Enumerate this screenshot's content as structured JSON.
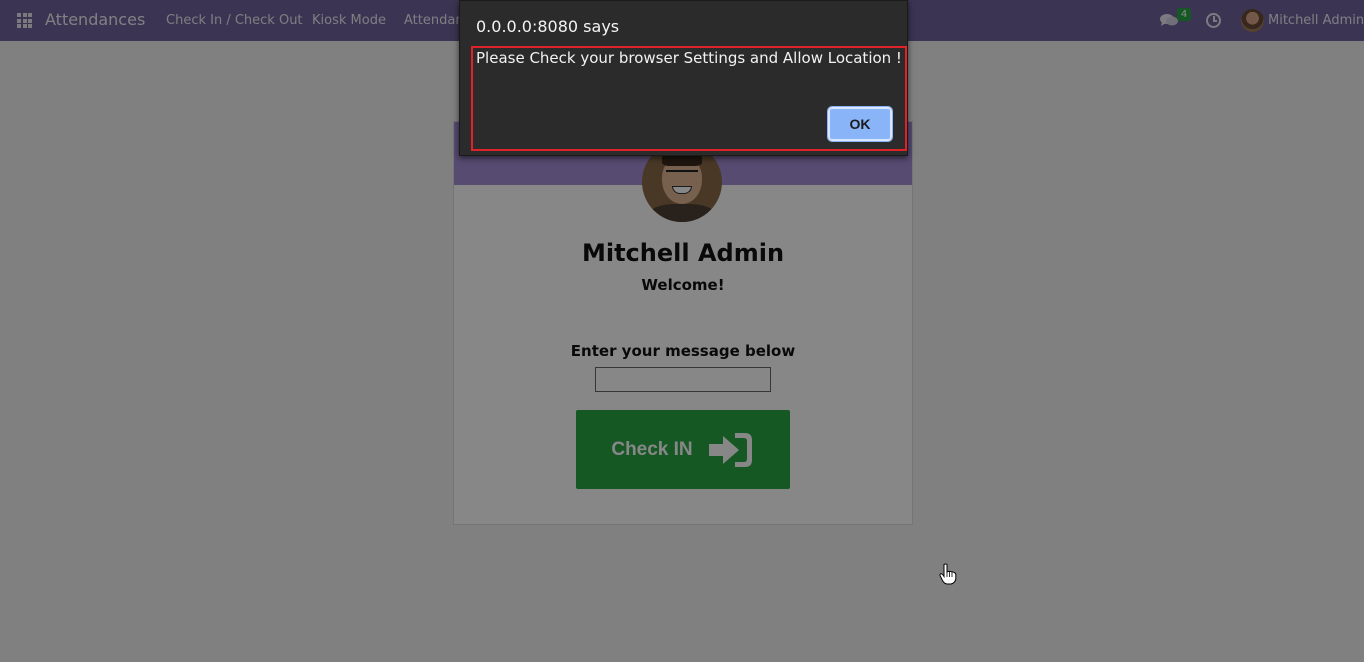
{
  "navbar": {
    "brand": "Attendances",
    "menu": [
      "Check In / Check Out",
      "Kiosk Mode",
      "Attendances"
    ],
    "message_count": "4",
    "user_name": "Mitchell Admin"
  },
  "card": {
    "employee_name": "Mitchell Admin",
    "greeting": "Welcome!",
    "message_label": "Enter your message below",
    "message_value": "",
    "checkin_label": "Check IN"
  },
  "dialog": {
    "title": "0.0.0.0:8080 says",
    "message": "Please Check your browser Settings and Allow Location !",
    "ok_label": "OK"
  },
  "colors": {
    "navbar": "#71639e",
    "card_header": "#a48ed8",
    "checkin_button": "#28a745",
    "badge": "#28a745",
    "ok_button": "#8ab4f8",
    "highlight": "#e0232b"
  },
  "icons": [
    "apps-grid-icon",
    "chat-icon",
    "clock-icon",
    "sign-in-icon",
    "hand-cursor-icon"
  ]
}
